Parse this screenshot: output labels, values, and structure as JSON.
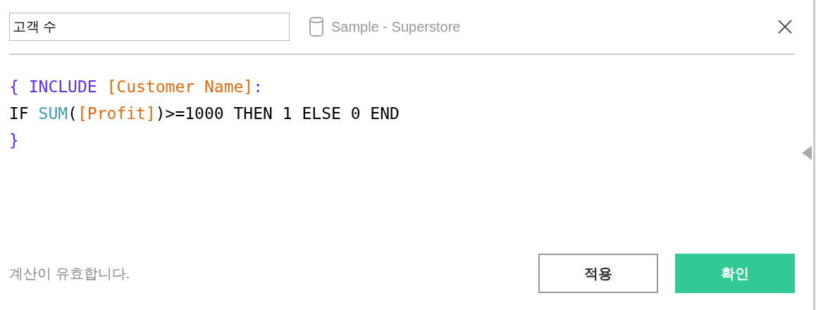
{
  "name_field": {
    "value": "고객 수"
  },
  "data_source": {
    "label": "Sample - Superstore"
  },
  "code_lines": [
    [
      {
        "kind": "brace",
        "text": "{ "
      },
      {
        "kind": "keyword",
        "text": "INCLUDE "
      },
      {
        "kind": "field",
        "text": "[Customer Name]"
      },
      {
        "kind": "brace",
        "text": ":"
      }
    ],
    [
      {
        "kind": "plain",
        "text": "IF "
      },
      {
        "kind": "function",
        "text": "SUM"
      },
      {
        "kind": "plain",
        "text": "("
      },
      {
        "kind": "field",
        "text": "[Profit]"
      },
      {
        "kind": "plain",
        "text": ")>=1000 THEN 1 ELSE 0 END"
      }
    ],
    [
      {
        "kind": "brace",
        "text": "}"
      }
    ]
  ],
  "status": "계산이 유효합니다.",
  "buttons": [
    {
      "kind": "secondary",
      "label": "적용"
    },
    {
      "kind": "primary",
      "label": "확인"
    }
  ]
}
